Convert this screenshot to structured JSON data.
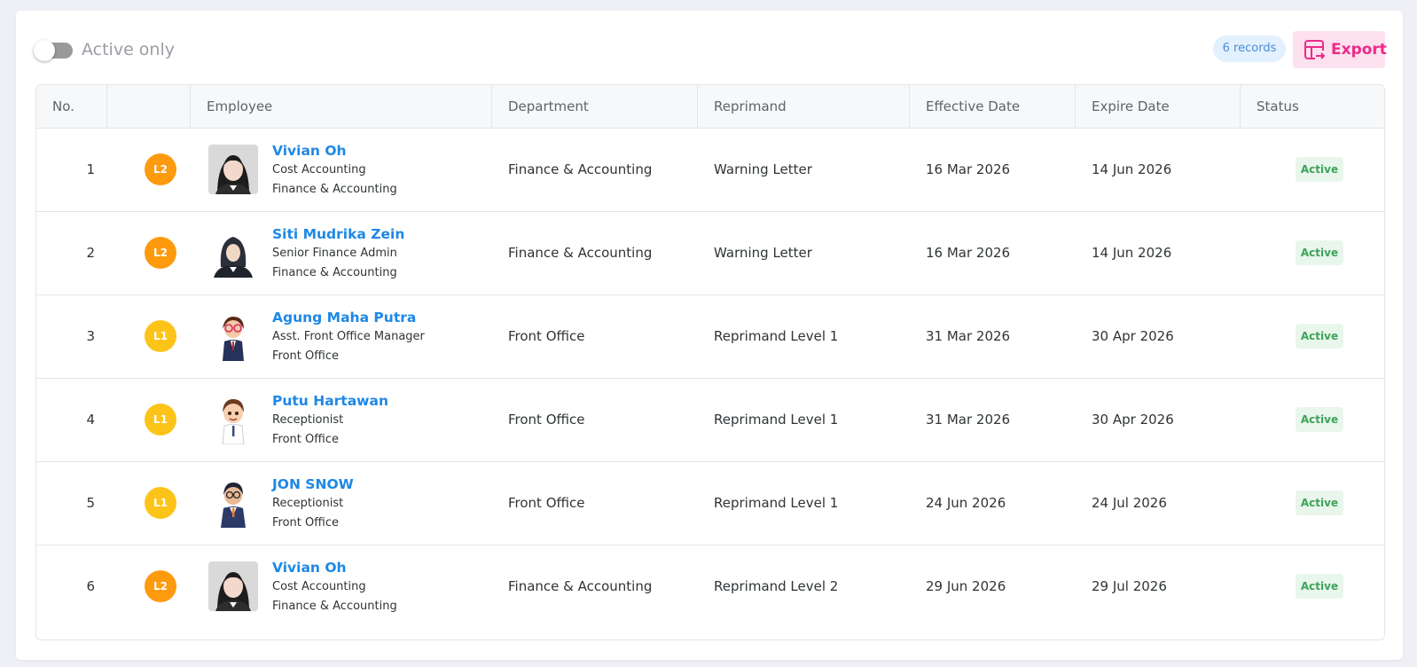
{
  "toolbar": {
    "toggle_label": "Active only",
    "toggle_on": false,
    "records": "6 records",
    "export_label": "Export",
    "export_color": "#ec2a8a"
  },
  "table": {
    "columns": [
      "No.",
      "",
      "Employee",
      "Department",
      "Reprimand",
      "Effective Date",
      "Expire Date",
      "Status"
    ],
    "rows": [
      {
        "no": "1",
        "level": "L2",
        "avatar": "female-hijab-none",
        "name": "Vivian Oh",
        "position": "Cost Accounting",
        "unit": "Finance & Accounting",
        "department": "Finance & Accounting",
        "reprimand": "Warning Letter",
        "effective": "16 Mar 2026",
        "expire": "14 Jun 2026",
        "status": "Active"
      },
      {
        "no": "2",
        "level": "L2",
        "avatar": "female-hijab",
        "name": "Siti Mudrika Zein",
        "position": "Senior Finance Admin",
        "unit": "Finance & Accounting",
        "department": "Finance & Accounting",
        "reprimand": "Warning Letter",
        "effective": "16 Mar 2026",
        "expire": "14 Jun 2026",
        "status": "Active"
      },
      {
        "no": "3",
        "level": "L1",
        "avatar": "cartoon-glasses",
        "name": "Agung Maha Putra",
        "position": "Asst. Front Office Manager",
        "unit": "Front Office",
        "department": "Front Office",
        "reprimand": "Reprimand Level 1",
        "effective": "31 Mar 2026",
        "expire": "30 Apr 2026",
        "status": "Active"
      },
      {
        "no": "4",
        "level": "L1",
        "avatar": "cartoon-boy",
        "name": "Putu Hartawan",
        "position": "Receptionist",
        "unit": "Front Office",
        "department": "Front Office",
        "reprimand": "Reprimand Level 1",
        "effective": "31 Mar 2026",
        "expire": "30 Apr 2026",
        "status": "Active"
      },
      {
        "no": "5",
        "level": "L1",
        "avatar": "cartoon-suit",
        "name": "JON SNOW",
        "position": "Receptionist",
        "unit": "Front Office",
        "department": "Front Office",
        "reprimand": "Reprimand Level 1",
        "effective": "24 Jun 2026",
        "expire": "24 Jul 2026",
        "status": "Active"
      },
      {
        "no": "6",
        "level": "L2",
        "avatar": "female-hijab-none",
        "name": "Vivian Oh",
        "position": "Cost Accounting",
        "unit": "Finance & Accounting",
        "department": "Finance & Accounting",
        "reprimand": "Reprimand Level 2",
        "effective": "29 Jun 2026",
        "expire": "29 Jul 2026",
        "status": "Active"
      }
    ]
  },
  "colors": {
    "level_L1": "#fcc419",
    "level_L2": "#fd9a0d",
    "name_link": "#1e88e5",
    "status_bg": "#e9f6ec",
    "status_text": "#3ea35a",
    "records_bg": "#e3f0fd",
    "records_text": "#4a8fd6"
  }
}
